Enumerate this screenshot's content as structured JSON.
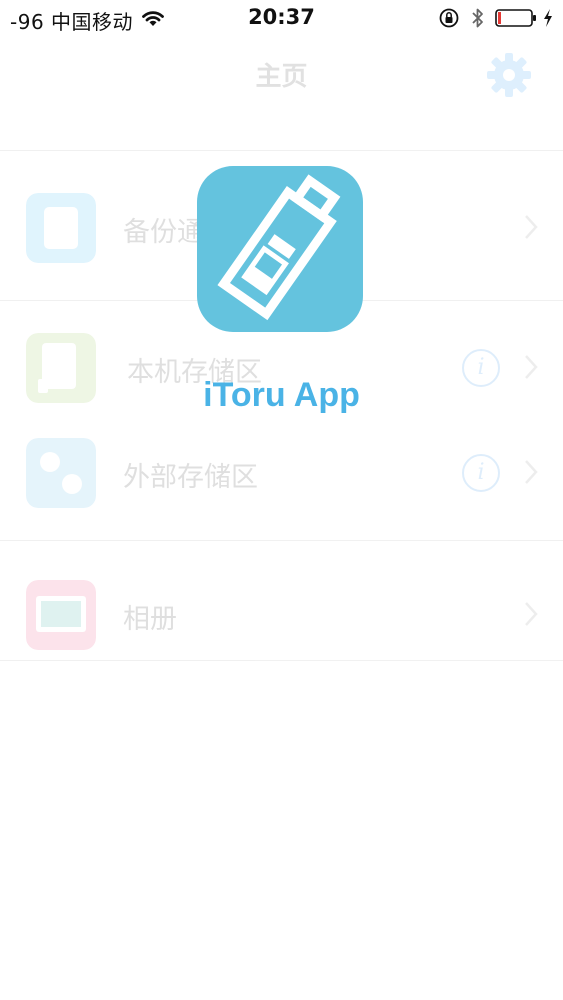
{
  "status_bar": {
    "signal": "-96 中国移动",
    "time": "20:37",
    "icons": [
      "wifi-icon",
      "orientation-lock-icon",
      "bluetooth-icon",
      "battery-low-icon",
      "charging-bolt-icon"
    ]
  },
  "nav": {
    "title": "主页",
    "settings_icon": "gear-icon"
  },
  "list": [
    {
      "label": "备份通讯录",
      "icon": "contacts-backup-icon",
      "has_info": false
    },
    {
      "label": "本机存储区",
      "icon": "phone-storage-icon",
      "has_info": true
    },
    {
      "label": "外部存储区",
      "icon": "external-storage-icon",
      "has_info": true
    },
    {
      "label": "相册",
      "icon": "photo-album-icon",
      "has_info": false
    }
  ],
  "splash": {
    "app_name": "iToru App",
    "logo_icon": "usb-drive-icon"
  },
  "colors": {
    "logo_background": "#64c3de",
    "app_name": "#4ab3e6",
    "accent_blue": "#1e88e5",
    "battery_low": "#e53935"
  }
}
